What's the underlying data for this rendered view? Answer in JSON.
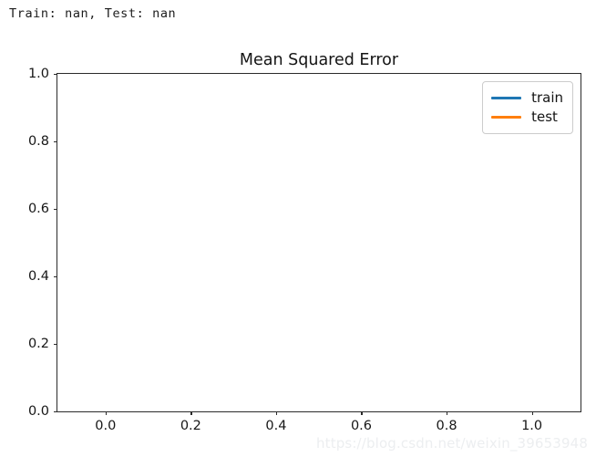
{
  "console": {
    "output_line": "Train: nan, Test: nan"
  },
  "figure": {
    "title": "Mean Squared Error",
    "background_color": "#ffffff",
    "axes_edge_color": "#2b2b2b"
  },
  "legend": {
    "position": "upper right",
    "entries": [
      {
        "label": "train",
        "color": "#1f77b4"
      },
      {
        "label": "test",
        "color": "#ff7f0e"
      }
    ]
  },
  "watermark": {
    "text": "https://blog.csdn.net/weixin_39653948",
    "color": "#eceef0"
  },
  "chart_data": {
    "type": "line",
    "title": "Mean Squared Error",
    "xlabel": "",
    "ylabel": "",
    "xlim": [
      -0.05,
      1.05
    ],
    "ylim": [
      -0.05,
      1.05
    ],
    "grid": false,
    "legend_position": "upper right",
    "xticks": [
      "0.0",
      "0.2",
      "0.4",
      "0.6",
      "0.8",
      "1.0"
    ],
    "xtick_values": [
      0.0,
      0.2,
      0.4,
      0.6,
      0.8,
      1.0
    ],
    "yticks": [
      "0.0",
      "0.2",
      "0.4",
      "0.6",
      "0.8",
      "1.0"
    ],
    "ytick_values": [
      0.0,
      0.2,
      0.4,
      0.6,
      0.8,
      1.0
    ],
    "series": [
      {
        "name": "train",
        "color": "#1f77b4",
        "x": [],
        "values": []
      },
      {
        "name": "test",
        "color": "#ff7f0e",
        "x": [],
        "values": []
      }
    ],
    "note": "Both series are empty (NaN loss values); plot area is blank."
  }
}
